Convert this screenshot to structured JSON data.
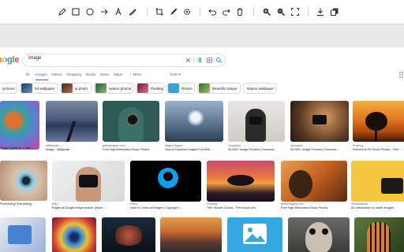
{
  "toolbar": {
    "tools": [
      {
        "name": "pencil-icon"
      },
      {
        "name": "rectangle-icon"
      },
      {
        "name": "circle-icon"
      },
      {
        "name": "arrow-icon"
      },
      {
        "name": "text-icon"
      },
      {
        "name": "highlighter-icon"
      },
      {
        "name": "crop-icon"
      },
      {
        "name": "pen-icon"
      },
      {
        "name": "settings-icon"
      },
      {
        "name": "undo-icon"
      },
      {
        "name": "redo-icon"
      },
      {
        "name": "trash-icon"
      },
      {
        "name": "zoom-in-icon"
      },
      {
        "name": "zoom-out-icon"
      },
      {
        "name": "fit-screen-icon"
      },
      {
        "name": "download-icon"
      },
      {
        "name": "copy-icon"
      }
    ]
  },
  "search": {
    "logo": "oogle",
    "query": "image"
  },
  "tabs": [
    "All",
    "Images",
    "Videos",
    "Shopping",
    "Books",
    "News",
    "Maps",
    "⋮ More"
  ],
  "active_tab": "Images",
  "tools_label": "Tools ▾",
  "chips": [
    {
      "label": "pictures",
      "color": "#ffffff"
    },
    {
      "label": "hd wallpaper",
      "color": "#3a5a8a"
    },
    {
      "label": "ai photo",
      "color": "#7a4a3a"
    },
    {
      "label": "Nature photos",
      "color": "#3f7a4a"
    },
    {
      "label": "Pixabay",
      "color": "#a0405a"
    },
    {
      "label": "Resize",
      "color": "#3aa0d8"
    },
    {
      "label": "Beautiful nature",
      "color": "#5a8a3a"
    },
    {
      "label": "Nature wallpaper",
      "color": "#ffffff"
    }
  ],
  "results_row1": [
    {
      "source": "",
      "title": "Image quality AI - Fake ..."
    },
    {
      "source": "Wikipedia",
      "title": "Image - Wikipedia"
    },
    {
      "source": "gettyimages.com",
      "title": "Free High-Resolution Stock Photos"
    },
    {
      "source": "Digital Digest",
      "title": "How to Optimize Images For Web ..."
    },
    {
      "source": "Unsplash",
      "title": "30,000+ Image Pictures | Downloa..."
    },
    {
      "source": "Unsplash",
      "title": "50,000+ Image Pictures | Downloa..."
    },
    {
      "source": "Pixabay",
      "title": "Pictures & HD Stock Photos - Free ..."
    }
  ],
  "results_row2": [
    {
      "source": "",
      "title": "Processing? Everything ..."
    },
    {
      "source": "BBC",
      "title": "Pages at Google image search 'peace ..."
    },
    {
      "source": "Pikoy",
      "title": "How to Check an Image's Copyright? ..."
    },
    {
      "source": "Pixabay",
      "title": "Tree Sunset Clouds - Free stock pho..."
    },
    {
      "source": "gettyimages.com",
      "title": "Free High-Resolution Stock Photos"
    },
    {
      "source": "Shutterstock",
      "title": "An Introduction to raster images"
    }
  ]
}
